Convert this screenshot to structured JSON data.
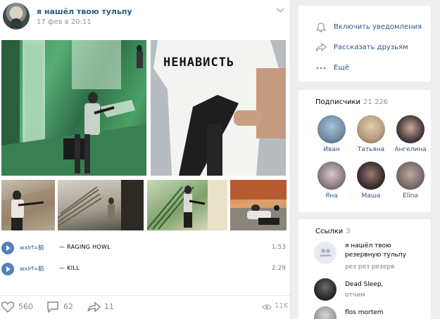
{
  "post": {
    "author": "я нашёл твою тульпу",
    "date": "17 фев в 20:11",
    "shirt_text": "НЕНАВИСТЬ",
    "audio": [
      {
        "artist": "wxlrf=脑",
        "dash": "—",
        "title": "RAGING HOWL",
        "duration": "1:53"
      },
      {
        "artist": "wxlrf=脑",
        "dash": "—",
        "title": "KILL",
        "duration": "2:29"
      }
    ],
    "likes": "560",
    "comments": "62",
    "shares": "11",
    "views": "11K"
  },
  "sidebar": {
    "actions": [
      {
        "label": "Включить уведомления",
        "icon": "bell-icon"
      },
      {
        "label": "Рассказать друзьям",
        "icon": "share-arrow-icon"
      },
      {
        "label": "Ещё",
        "icon": "more-dots-icon"
      }
    ],
    "subscribers": {
      "title": "Подписчики",
      "count": "21 226",
      "people": [
        {
          "name": "Иван",
          "color": "#6f8ca3"
        },
        {
          "name": "Татьяна",
          "color": "#b49a7c"
        },
        {
          "name": "Ангелина",
          "color": "#4a3b3a"
        },
        {
          "name": "Яна",
          "color": "#8a7a7e"
        },
        {
          "name": "Маша",
          "color": "#3b2e2c"
        },
        {
          "name": "Elina",
          "color": "#7a6a66"
        }
      ]
    },
    "links": {
      "title": "Ссылки",
      "count": "3",
      "items": [
        {
          "title": "я нашёл твою резервную тульпу",
          "desc": "рез рез резерв",
          "icon": "group-icon"
        },
        {
          "title": "Dead Sleep,",
          "desc": "отчим",
          "icon": "avatar-icon"
        },
        {
          "title": "flos mortem",
          "desc": "",
          "icon": "avatar-icon"
        }
      ]
    }
  }
}
